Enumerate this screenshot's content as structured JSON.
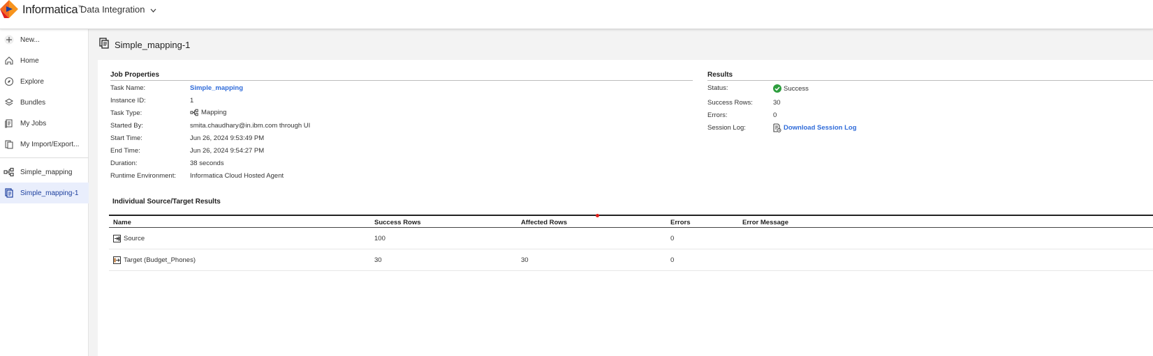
{
  "header": {
    "brand": "Informatica",
    "app_switcher": "Data Integration"
  },
  "sidebar": {
    "items": [
      {
        "label": "New...",
        "icon": "plus-icon"
      },
      {
        "label": "Home",
        "icon": "home-icon"
      },
      {
        "label": "Explore",
        "icon": "compass-icon"
      },
      {
        "label": "Bundles",
        "icon": "stack-icon"
      },
      {
        "label": "My Jobs",
        "icon": "jobs-icon"
      },
      {
        "label": "My Import/Export...",
        "icon": "import-export-icon"
      }
    ],
    "open_tabs": [
      {
        "label": "Simple_mapping",
        "icon": "mapping-icon"
      },
      {
        "label": "Simple_mapping-1",
        "icon": "job-instance-icon",
        "active": true
      }
    ]
  },
  "page": {
    "title": "Simple_mapping-1"
  },
  "job_properties": {
    "section_title": "Job Properties",
    "labels": {
      "task_name": "Task Name:",
      "instance_id": "Instance ID:",
      "task_type": "Task Type:",
      "started_by": "Started By:",
      "start_time": "Start Time:",
      "end_time": "End Time:",
      "duration": "Duration:",
      "runtime_env": "Runtime Environment:"
    },
    "values": {
      "task_name": "Simple_mapping",
      "instance_id": "1",
      "task_type": "Mapping",
      "started_by": "smita.chaudhary@in.ibm.com through UI",
      "start_time": "Jun 26, 2024 9:53:49 PM",
      "end_time": "Jun 26, 2024 9:54:27 PM",
      "duration": "38 seconds",
      "runtime_env": "Informatica Cloud Hosted Agent"
    }
  },
  "results": {
    "section_title": "Results",
    "labels": {
      "status": "Status:",
      "success_rows": "Success Rows:",
      "errors": "Errors:",
      "session_log": "Session Log:"
    },
    "values": {
      "status": "Success",
      "success_rows": "30",
      "errors": "0",
      "session_log": "Download Session Log"
    },
    "status_color": "#2e9e3e"
  },
  "individual_results": {
    "section_title": "Individual Source/Target Results",
    "columns": [
      "Name",
      "Success Rows",
      "Affected Rows",
      "Errors",
      "Error Message"
    ],
    "rows": [
      {
        "name": "Source",
        "success_rows": "100",
        "affected_rows": "",
        "errors": "0",
        "error_message": "",
        "icon": "source-icon"
      },
      {
        "name": "Target (Budget_Phones)",
        "success_rows": "30",
        "affected_rows": "30",
        "errors": "0",
        "error_message": "",
        "icon": "target-icon"
      }
    ]
  },
  "colors": {
    "accent": "#2f6bd9",
    "logo_orange": "#f26a21",
    "logo_red": "#e0201b",
    "logo_blue": "#1c3f9e"
  }
}
